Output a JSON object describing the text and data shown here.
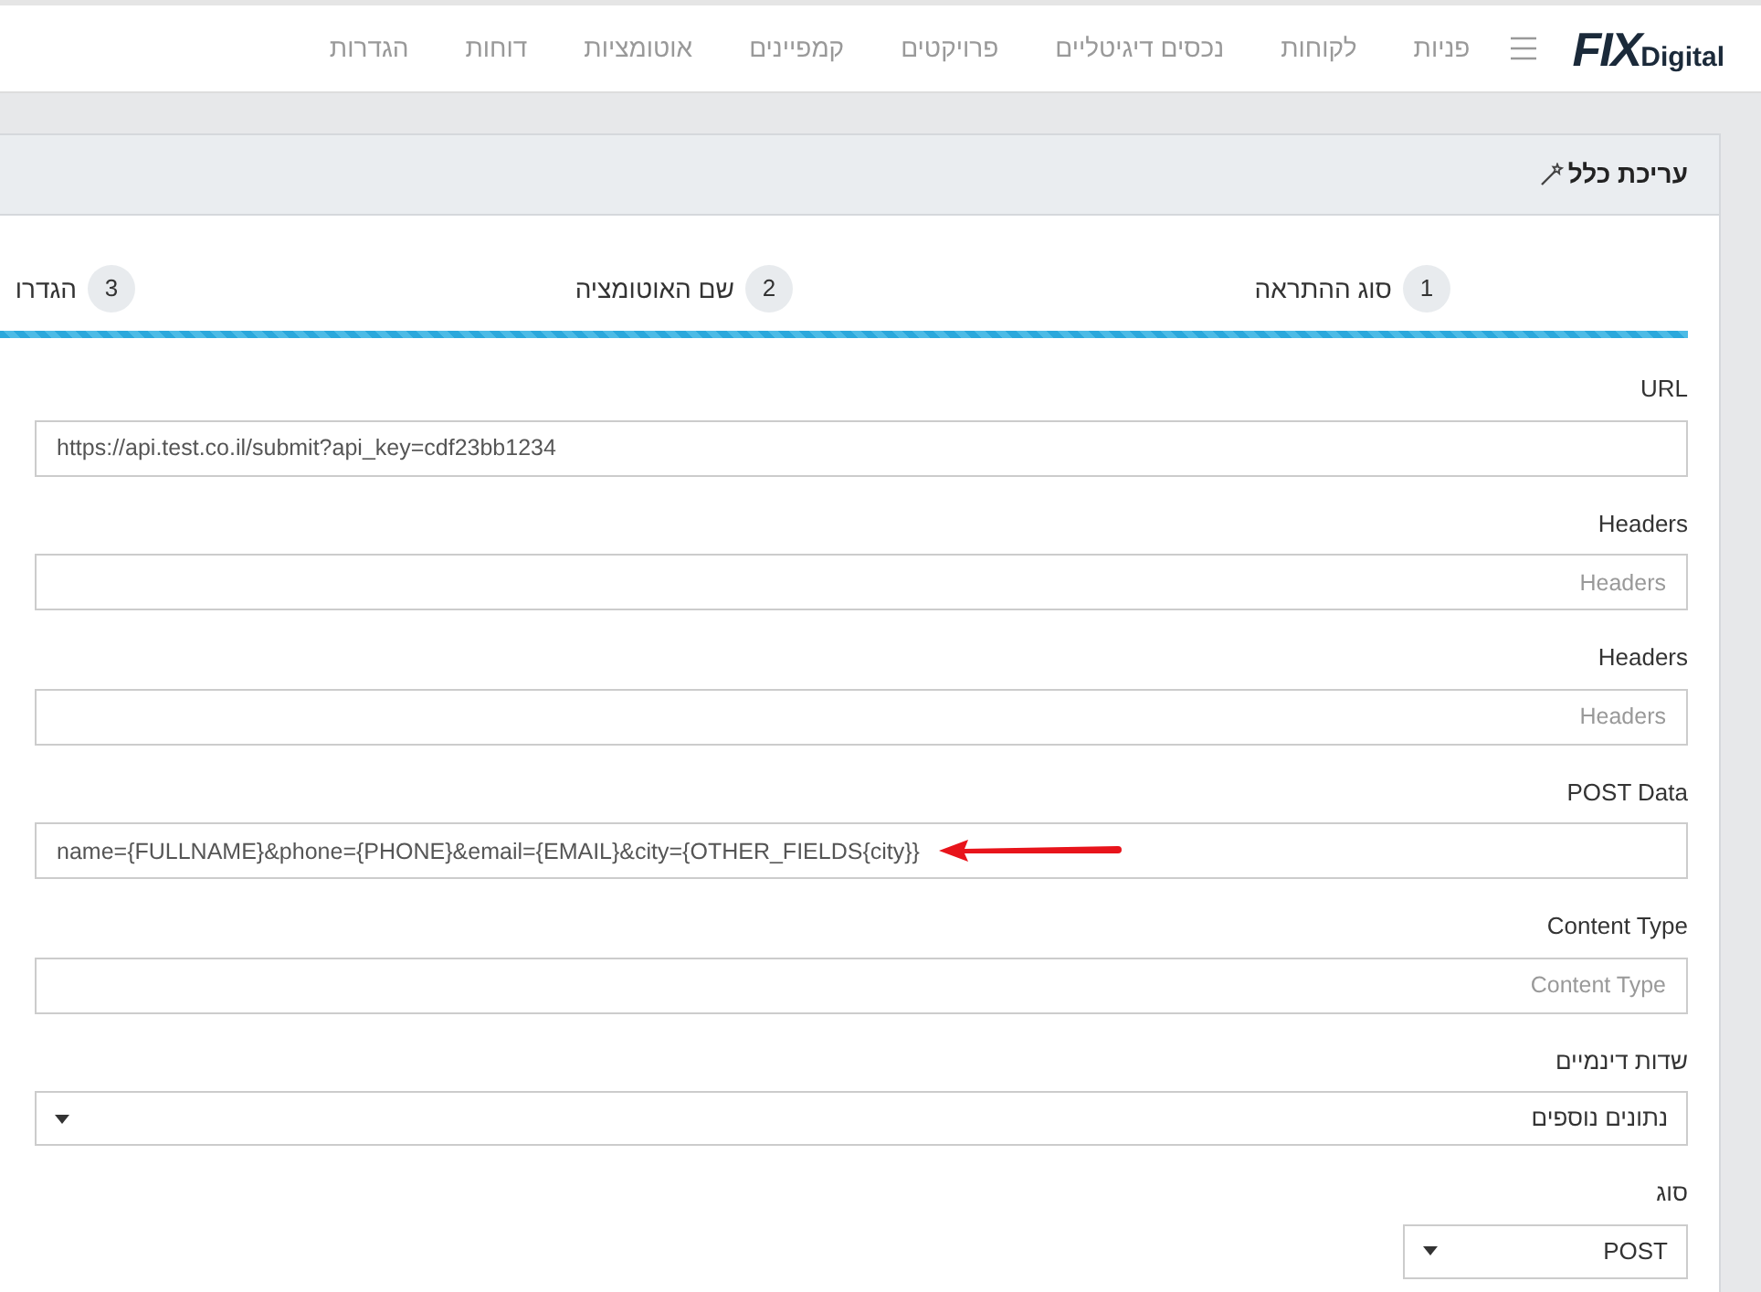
{
  "nav": {
    "logo": {
      "mark": "FIX",
      "text": "Digital"
    },
    "items": [
      {
        "label": "פניות"
      },
      {
        "label": "לקוחות"
      },
      {
        "label": "נכסים דיגיטליים"
      },
      {
        "label": "פרויקטים"
      },
      {
        "label": "קמפיינים"
      },
      {
        "label": "אוטומציות"
      },
      {
        "label": "דוחות"
      },
      {
        "label": "הגדרות"
      }
    ]
  },
  "card": {
    "title": "עריכת כלל",
    "steps": [
      {
        "number": "1",
        "label": "סוג ההתראה"
      },
      {
        "number": "2",
        "label": "שם האוטומציה"
      },
      {
        "number": "3",
        "label": "הגדרו"
      }
    ],
    "progress": {
      "level": 1
    },
    "fields": [
      {
        "kind": "ltr_text",
        "label": "URL",
        "value": "https://api.test.co.il/submit?api_key=cdf23bb1234"
      },
      {
        "kind": "text",
        "label": "Headers",
        "placeholder": "Headers"
      },
      {
        "kind": "text",
        "label": "Headers",
        "placeholder": "Headers"
      },
      {
        "kind": "ltr_text",
        "label": "POST Data",
        "value": "name={FULLNAME}&phone={PHONE}&email={EMAIL}&city={OTHER_FIELDS{city}}",
        "annotated": true
      },
      {
        "kind": "text",
        "label": "Content Type",
        "placeholder": "Content Type"
      },
      {
        "kind": "select",
        "label": "שדות דינמיים",
        "value": "נתונים נוספים"
      },
      {
        "kind": "small_select",
        "label": "סוג",
        "value": "POST"
      }
    ]
  }
}
